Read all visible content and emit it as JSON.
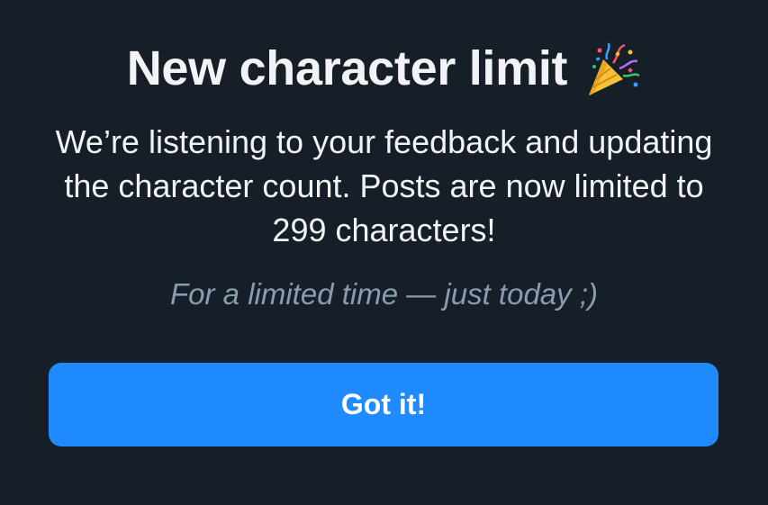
{
  "dialog": {
    "title": "New character limit",
    "title_icon": "party-popper-icon",
    "body": "We’re listening to your feedback and updating the character count. Posts are now limited to 299 characters!",
    "subtext": "For a limited time — just today ;)",
    "confirm_label": "Got it!"
  },
  "colors": {
    "background": "#161e27",
    "text": "#f1f3f5",
    "muted_text": "#8b9bb0",
    "button": "#208bfe"
  }
}
